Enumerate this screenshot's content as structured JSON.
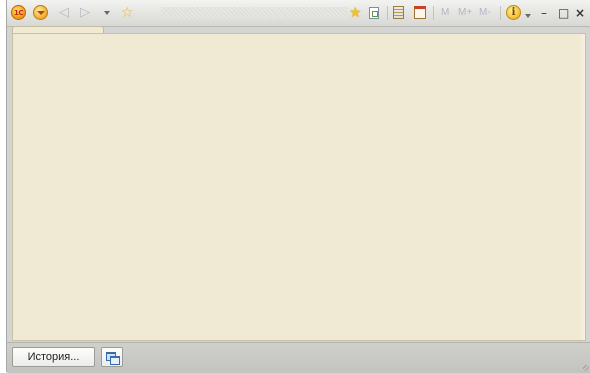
{
  "toolbar": {
    "logo_text": "1С",
    "back_icon": "back-arrow-icon",
    "forward_icon": "forward-arrow-icon",
    "history_dropdown_icon": "chevron-down-icon",
    "favorites_icon": "star-icon",
    "add_favorite_icon": "star-add-icon",
    "memory": {
      "m": "M",
      "m_plus": "M+",
      "m_minus": "M-"
    },
    "info_text": "i",
    "minimize": "–",
    "maximize": "□",
    "close": "×"
  },
  "statusbar": {
    "history_label": "История...",
    "windows_icon": "windows-list-icon"
  },
  "colors": {
    "content_bg": "#f0e9d4",
    "toolbar_bg": "#e3e3e0",
    "statusbar_bg": "#c9c9c6",
    "accent_orange": "#f2a51c"
  }
}
